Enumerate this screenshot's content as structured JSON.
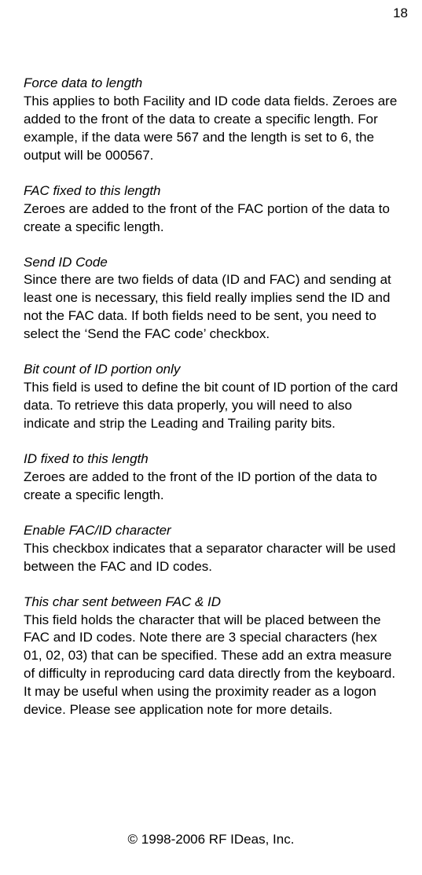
{
  "page_number": "18",
  "sections": [
    {
      "title": "Force data to length",
      "body": "This applies to both Facility and ID code data fields. Zeroes are added to the front of the data to create a specific length. For example, if the data were 567 and the length is set to 6, the output will be 000567."
    },
    {
      "title": "FAC fixed to this length",
      "body": "Zeroes are added to the front of the FAC portion of the data to create a specific length."
    },
    {
      "title": "Send ID Code",
      "body": "Since there are two fields of data (ID and FAC) and sending at least one is necessary, this field really implies send the ID and not the FAC data. If both fields need to be sent, you need to select the ‘Send the FAC code’ checkbox."
    },
    {
      "title": "Bit count of ID portion only",
      "body": "This field is used to define the bit count of ID portion of the card data. To retrieve this data properly, you will need to also indicate and strip the Leading and Trailing parity bits."
    },
    {
      "title": "ID fixed to this length",
      "body": "Zeroes are added to the front of the ID portion of the data to create a specific length."
    },
    {
      "title": "Enable FAC/ID character",
      "body": "This checkbox indicates that a separator character will be used between the FAC and ID codes."
    },
    {
      "title": "This char sent between FAC & ID",
      "body": "This field holds the character that will be placed between the FAC and ID codes. Note there are 3 special characters (hex 01, 02, 03) that can be specified. These add an extra measure of difficulty in reproducing card data directly from the keyboard. It may be useful when using the proximity reader as a logon device. Please see application note for more details."
    }
  ],
  "footer": "© 1998-2006 RF IDeas, Inc."
}
